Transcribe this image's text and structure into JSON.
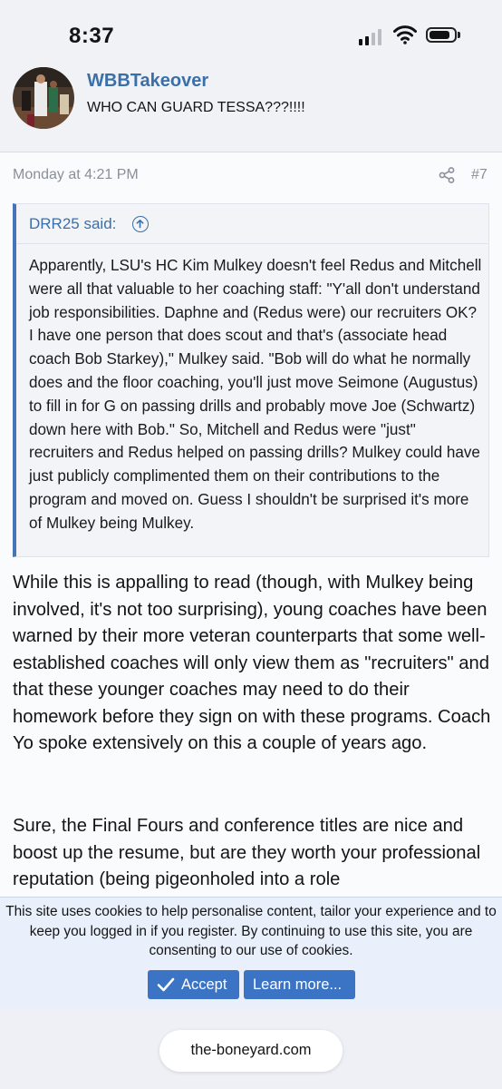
{
  "status_bar": {
    "time": "8:37"
  },
  "post": {
    "username": "WBBTakeover",
    "user_title": "WHO CAN GUARD TESSA???!!!!",
    "date": "Monday at 4:21 PM",
    "post_number": "#7",
    "quote": {
      "author_line": "DRR25 said:",
      "text": "Apparently, LSU's HC Kim Mulkey doesn't feel Redus and Mitchell were all that valuable to her coaching staff: \"Y'all don't understand job responsibilities. Daphne and (Redus were) our recruiters OK? I have one person that does scout and that's (associate head coach Bob Starkey),\" Mulkey said. \"Bob will do what he normally does and the floor coaching, you'll just move Seimone (Augustus) to fill in for G on passing drills and probably move Joe (Schwartz) down here with Bob.\" So, Mitchell and Redus were \"just\" recruiters and Redus helped on passing drills? Mulkey could have just publicly complimented them on their contributions to the program and moved on. Guess I shouldn't be surprised it's more of Mulkey being Mulkey."
    },
    "paragraph_1": "While this is appalling to read (though, with Mulkey being involved, it's not too surprising), young coaches have been warned by their more veteran counterparts that some well-established coaches will only view them as \"recruiters\" and that these younger coaches may need to do their homework before they sign on with these programs. Coach Yo spoke extensively on this a couple of years ago.",
    "paragraph_2": "Sure, the Final Fours and conference titles are nice and boost up the resume, but are they worth your professional reputation (being pigeonholed into a role"
  },
  "cookie_notice": {
    "text": "This site uses cookies to help personalise content, tailor your experience and to keep you logged in if you register. By continuing to use this site, you are consenting to our use of cookies.",
    "accept_label": "Accept",
    "learn_more_label": "Learn more..."
  },
  "browser": {
    "url": "the-boneyard.com"
  },
  "icons": {
    "signal": "cellular-signal-icon",
    "wifi": "wifi-icon",
    "battery": "battery-icon",
    "share": "share-icon",
    "quote_jump": "arrow-up-circle-icon",
    "accept": "checkmark-icon"
  },
  "colors": {
    "link": "#3a6fa8",
    "accent": "#4a72b8",
    "button": "#3b74c5",
    "cookie_bg": "#e9f0fb"
  }
}
